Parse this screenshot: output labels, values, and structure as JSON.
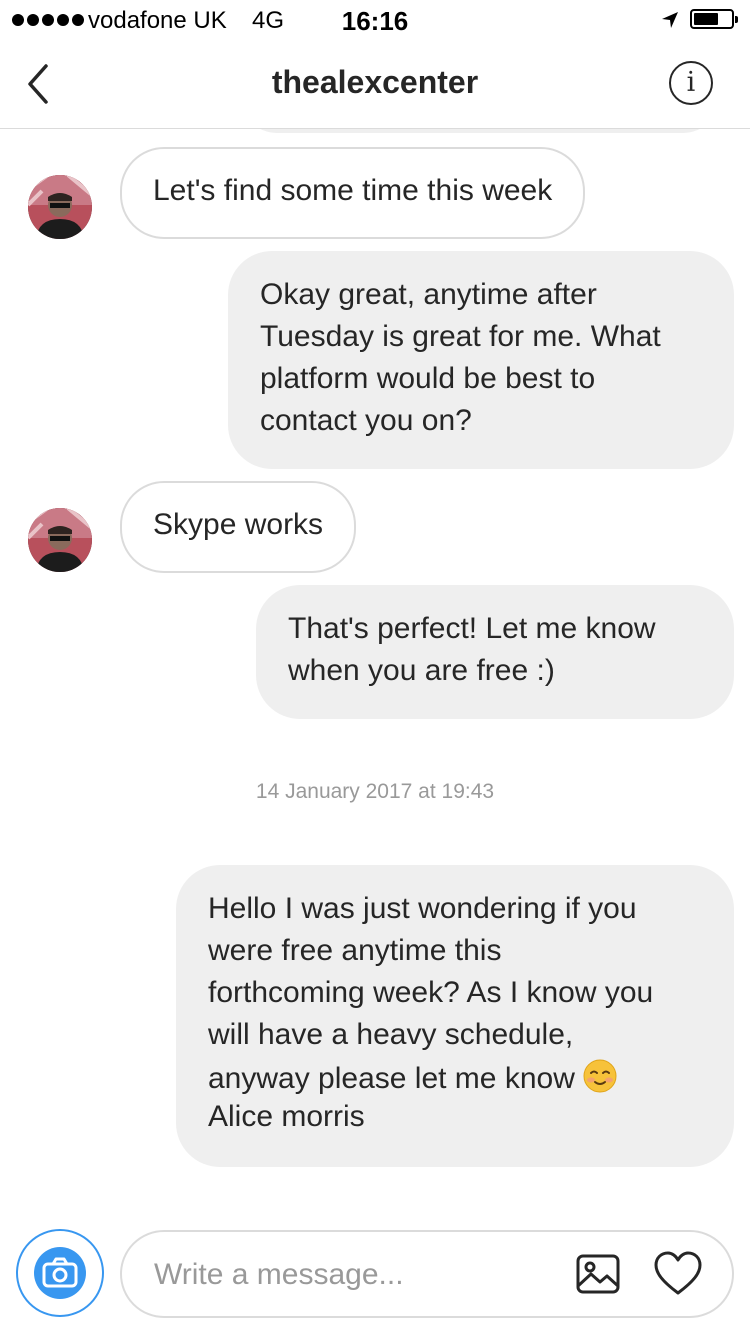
{
  "status_bar": {
    "carrier": "vodafone UK",
    "network": "4G",
    "time": "16:16",
    "signal_bars": 5,
    "icons": [
      "location-arrow-icon",
      "battery-icon"
    ]
  },
  "header": {
    "title": "thealexcenter",
    "back_icon": "chevron-left-icon",
    "info_label": "i"
  },
  "messages": [
    {
      "direction": "incoming",
      "text": "Let's find some time this week"
    },
    {
      "direction": "outgoing",
      "lines": [
        "Okay great, anytime after",
        "Tuesday is great for me. What",
        "platform would be best to",
        "contact you on?"
      ]
    },
    {
      "direction": "incoming",
      "text": "Skype works"
    },
    {
      "direction": "outgoing",
      "lines": [
        "That's perfect! Let me know",
        "when you are free :)"
      ]
    },
    {
      "type": "timestamp",
      "text": "14 January 2017 at 19:43"
    },
    {
      "direction": "outgoing",
      "lines": [
        "Hello I was just wondering if you",
        "were free anytime this",
        "forthcoming week? As I know you",
        "will have a heavy schedule,",
        "anyway please let me know",
        "Alice morris"
      ],
      "emoji": "smiling-face-icon"
    }
  ],
  "composer": {
    "placeholder": "Write a message...",
    "value": "",
    "icons": [
      "camera-icon",
      "image-icon",
      "heart-icon"
    ]
  },
  "colors": {
    "accent": "#3897f0",
    "outgoing_bubble": "#efefef",
    "incoming_border": "#dbdbdb",
    "text": "#262626",
    "muted_text": "#999999"
  }
}
